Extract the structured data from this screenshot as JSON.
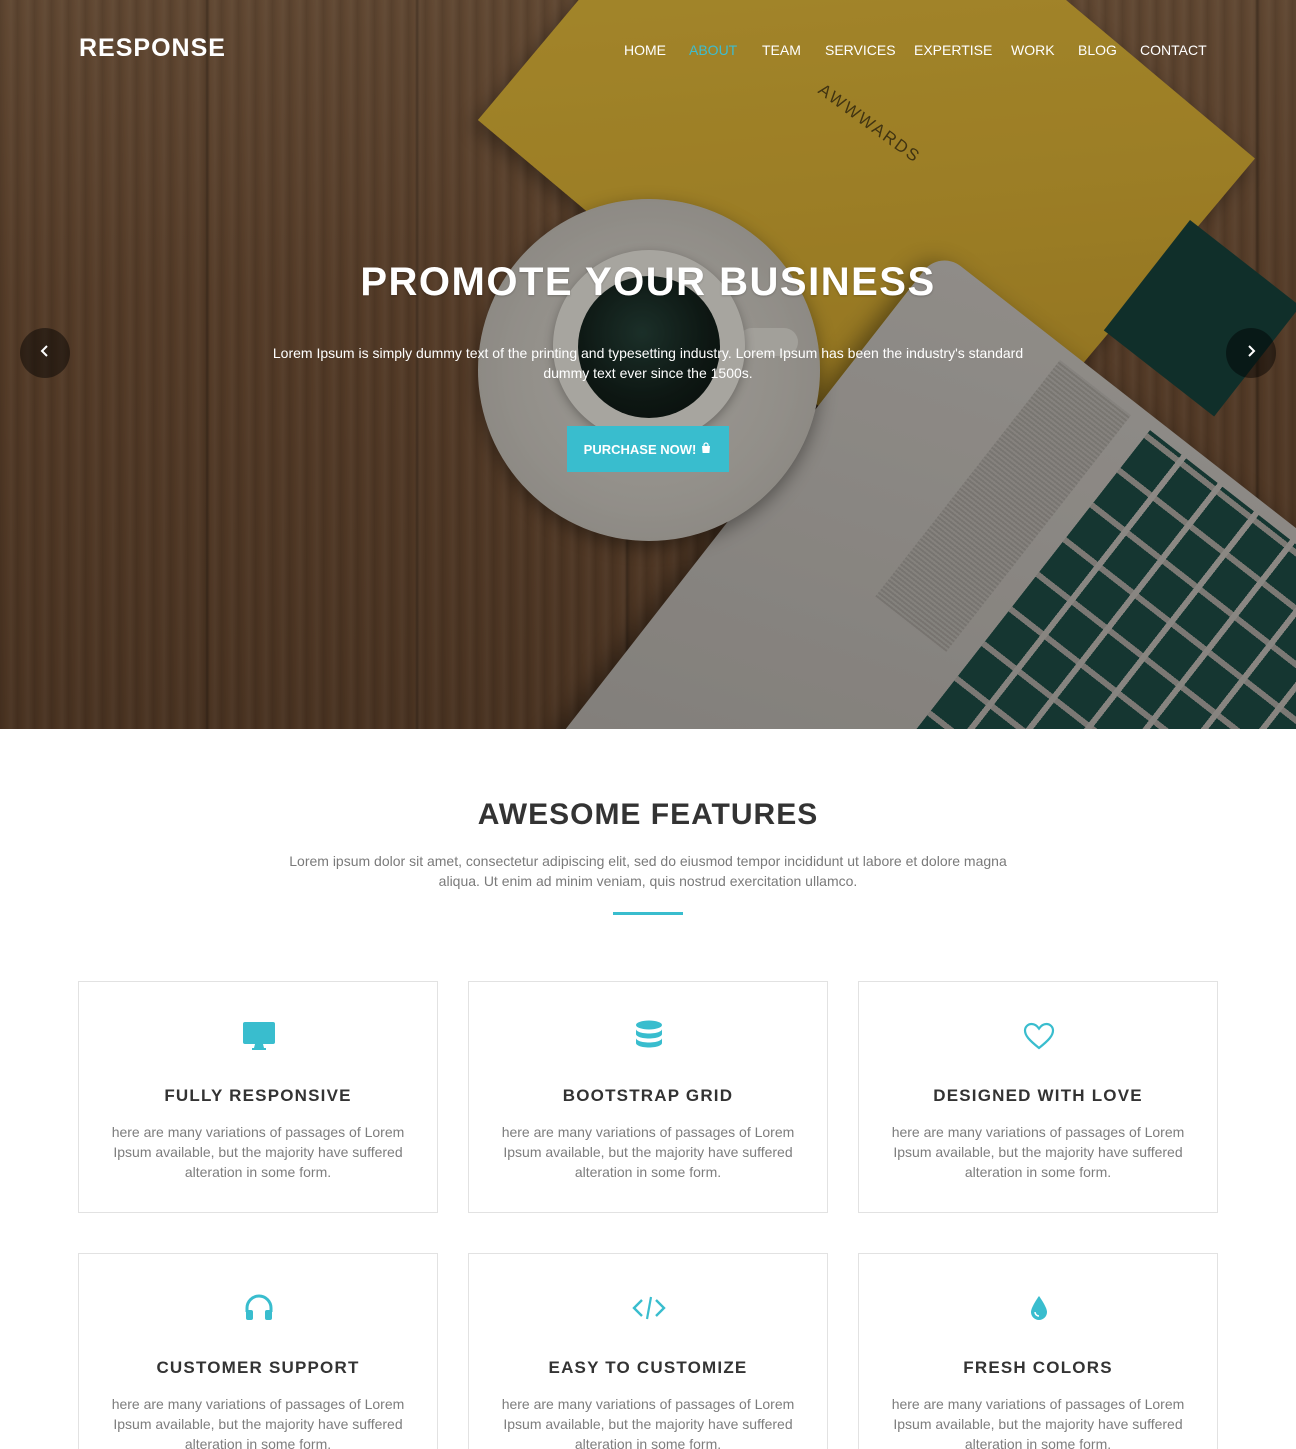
{
  "brand": "RESPONSE",
  "nav": {
    "items": [
      {
        "label": "HOME",
        "active": false
      },
      {
        "label": "ABOUT",
        "active": true
      },
      {
        "label": "TEAM",
        "active": false
      },
      {
        "label": "SERVICES",
        "active": false
      },
      {
        "label": "EXPERTISE",
        "active": false
      },
      {
        "label": "WORK",
        "active": false
      },
      {
        "label": "BLOG",
        "active": false
      },
      {
        "label": "CONTACT",
        "active": false
      }
    ]
  },
  "hero": {
    "title": "PROMOTE YOUR BUSINESS",
    "text": "Lorem Ipsum is simply dummy text of the printing and typesetting industry. Lorem Ipsum has been the industry's standard dummy text ever since the 1500s.",
    "button_label": "PURCHASE NOW!",
    "button_icon": "shopping-bag-icon",
    "notebook_text": "AWWWARDS",
    "prev_icon": "chevron-left-icon",
    "next_icon": "chevron-right-icon"
  },
  "features": {
    "title": "AWESOME FEATURES",
    "text": "Lorem ipsum dolor sit amet, consectetur adipiscing elit, sed do eiusmod tempor incididunt ut labore et dolore magna aliqua. Ut enim ad minim veniam, quis nostrud exercitation ullamco.",
    "cards": [
      {
        "icon": "desktop-icon",
        "title": "FULLY RESPONSIVE",
        "text": "here are many variations of passages of Lorem Ipsum available, but the majority have suffered alteration in some form."
      },
      {
        "icon": "database-icon",
        "title": "BOOTSTRAP GRID",
        "text": "here are many variations of passages of Lorem Ipsum available, but the majority have suffered alteration in some form."
      },
      {
        "icon": "heart-icon",
        "title": "DESIGNED WITH LOVE",
        "text": "here are many variations of passages of Lorem Ipsum available, but the majority have suffered alteration in some form."
      },
      {
        "icon": "headphones-icon",
        "title": "CUSTOMER SUPPORT",
        "text": "here are many variations of passages of Lorem Ipsum available, but the majority have suffered alteration in some form."
      },
      {
        "icon": "code-icon",
        "title": "EASY TO CUSTOMIZE",
        "text": "here are many variations of passages of Lorem Ipsum available, but the majority have suffered alteration in some form."
      },
      {
        "icon": "droplet-icon",
        "title": "FRESH COLORS",
        "text": "here are many variations of passages of Lorem Ipsum available, but the majority have suffered alteration in some form."
      }
    ]
  },
  "colors": {
    "accent": "#39bdce",
    "heading": "#333333",
    "body_text": "#7a7a7a",
    "card_border": "#e2e2e2"
  }
}
